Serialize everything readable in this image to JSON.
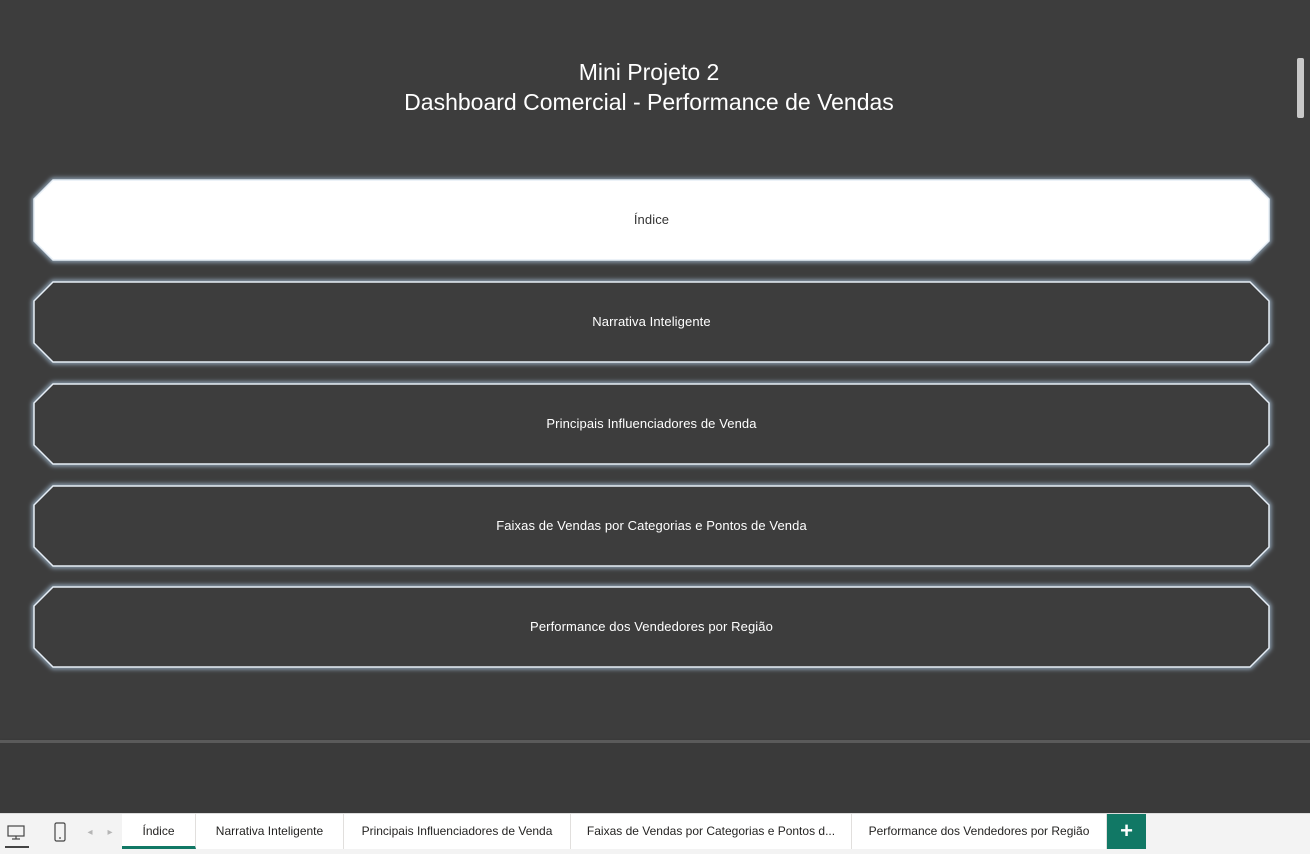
{
  "report": {
    "title_line1": "Mini Projeto 2",
    "title_line2": "Dashboard Comercial - Performance de Vendas"
  },
  "nav_buttons": [
    {
      "label": "Índice",
      "active": true
    },
    {
      "label": "Narrativa Inteligente",
      "active": false
    },
    {
      "label": "Principais Influenciadores de Venda",
      "active": false
    },
    {
      "label": "Faixas de Vendas por Categorias e Pontos de Venda",
      "active": false
    },
    {
      "label": "Performance dos Vendedores por Região",
      "active": false
    }
  ],
  "tabbar": {
    "icons": [
      "desktop-view-icon",
      "mobile-view-icon",
      "chevron-left-icon",
      "chevron-right-icon"
    ],
    "tabs": [
      {
        "label": "Índice",
        "active": true
      },
      {
        "label": "Narrativa Inteligente",
        "active": false
      },
      {
        "label": "Principais Influenciadores de Venda",
        "active": false
      },
      {
        "label": "Faixas de Vendas por Categorias e Pontos d...",
        "active": false
      },
      {
        "label": "Performance dos Vendedores por Região",
        "active": false
      }
    ],
    "add_label": "+"
  },
  "colors": {
    "background": "#3d3d3d",
    "button_active_fill": "#ffffff",
    "button_border": "#e6eef6",
    "button_glow": "#9fb6cc",
    "accent": "#117865"
  }
}
